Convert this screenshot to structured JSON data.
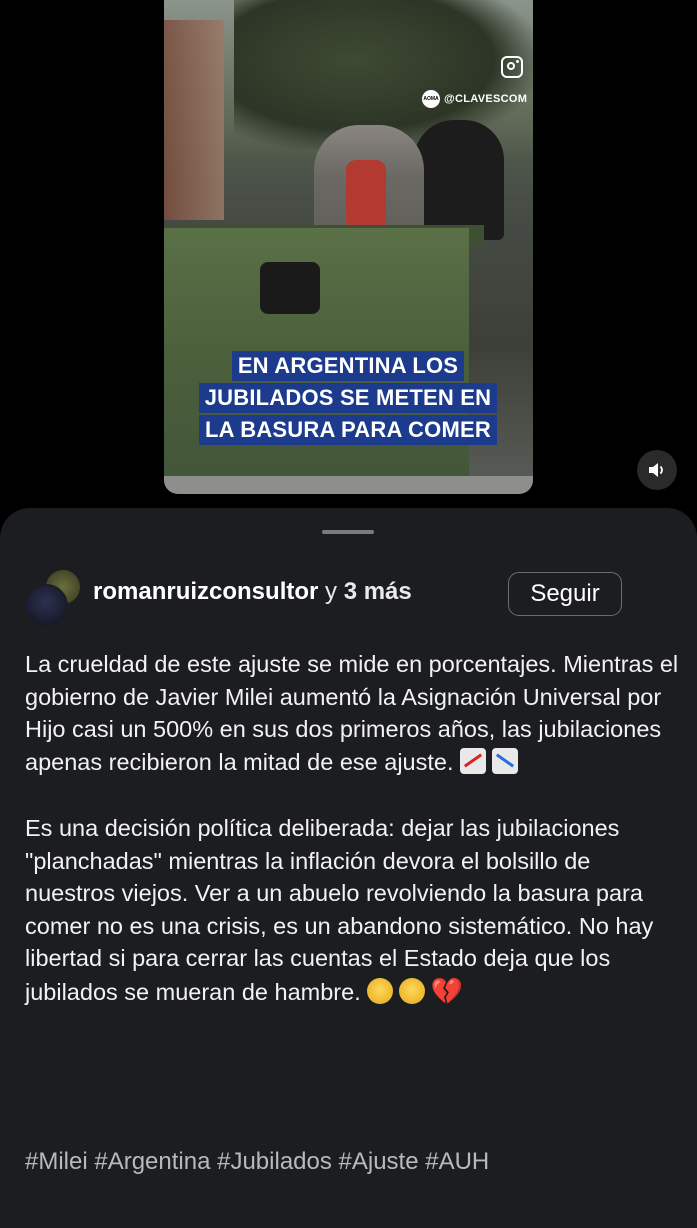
{
  "video": {
    "watermark": "@CLAVESCOM",
    "watermark_logo": "AOMA",
    "caption_lines": [
      "EN ARGENTINA LOS",
      "JUBILADOS SE METEN EN",
      "LA BASURA PARA COMER"
    ],
    "sound_icon": "speaker-icon"
  },
  "post": {
    "author": "romanruizconsultor",
    "coauthors_connector": "y",
    "coauthors_text": "3 más",
    "follow_label": "Seguir",
    "paragraph1": "La crueldad de este ajuste se mide en porcentajes. Mientras el gobierno de Javier Milei aumentó la Asignación Universal por Hijo casi un 500% en sus dos primeros años, las jubilaciones apenas recibieron la mitad de ese ajuste.",
    "paragraph2": "Es una decisión política deliberada: dejar las jubilaciones \"planchadas\" mientras la inflación devora el bolsillo de nuestros viejos. Ver a un abuelo revolviendo la basura para comer no es una crisis, es un abandono sistemático. No hay libertad si para cerrar las cuentas el Estado deja que los jubilados se mueran de hambre.",
    "hashtags": "#Milei #Argentina #Jubilados #Ajuste #AUH"
  }
}
